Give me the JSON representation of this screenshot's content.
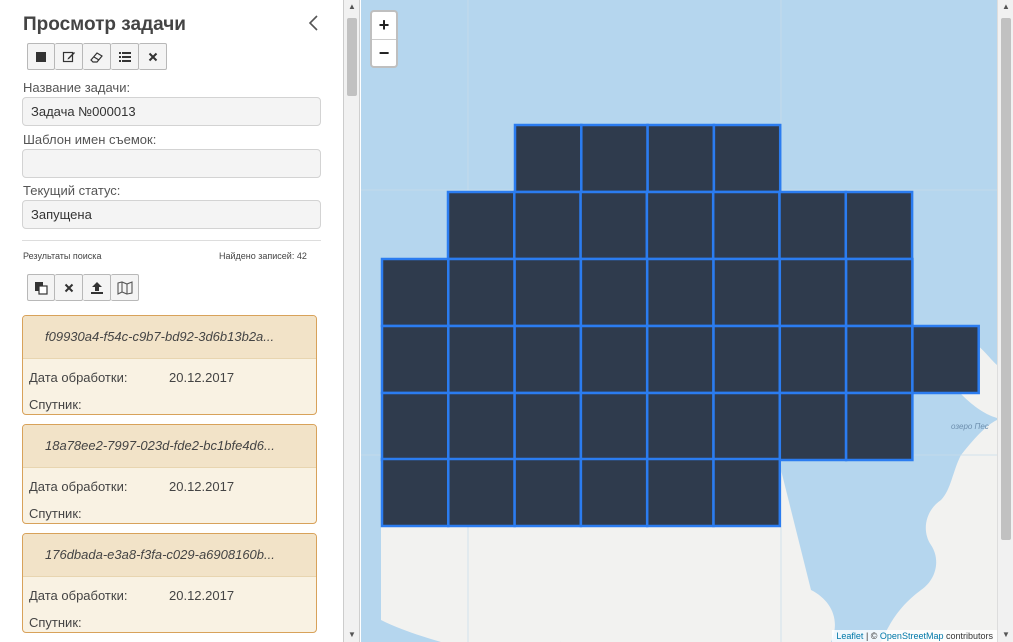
{
  "panel": {
    "title": "Просмотр задачи",
    "collapse_icon": "‹",
    "task_toolbar": [
      "stop-icon",
      "edit-icon",
      "eraser-icon",
      "list-icon",
      "close-icon"
    ],
    "task_name_label": "Название задачи:",
    "task_name_value": "Задача №000013",
    "template_label": "Шаблон имен съемок:",
    "template_value": "",
    "status_label": "Текущий статус:",
    "status_value": "Запущена",
    "results_label": "Результаты поиска",
    "found_label": "Найдено записей: 42",
    "results_toolbar": [
      "copy-icon",
      "close-icon",
      "upload-icon",
      "map-icon"
    ],
    "results": [
      {
        "id": "f09930a4-f54c-c9b7-bd92-3d6b13b2a...",
        "date_label": "Дата обработки:",
        "date_value": "20.12.2017",
        "satellite_label": "Спутник:"
      },
      {
        "id": "18a78ee2-7997-023d-fde2-bc1bfe4d6...",
        "date_label": "Дата обработки:",
        "date_value": "20.12.2017",
        "satellite_label": "Спутник:"
      },
      {
        "id": "176dbada-e3a8-f3fa-c029-a6908160b...",
        "date_label": "Дата обработки:",
        "date_value": "20.12.2017",
        "satellite_label": "Спутник:"
      }
    ]
  },
  "map": {
    "zoom_in": "+",
    "zoom_out": "−",
    "lake_label": "озеро Пес",
    "attribution_leaflet": "Leaflet",
    "attribution_sep": " | © ",
    "attribution_osm": "OpenStreetMap",
    "attribution_tail": " contributors",
    "colors": {
      "water": "#b5d6ee",
      "land": "#f2f2f0",
      "tile": "#2f3b4d",
      "tile_border": "#2b7cf0"
    }
  }
}
